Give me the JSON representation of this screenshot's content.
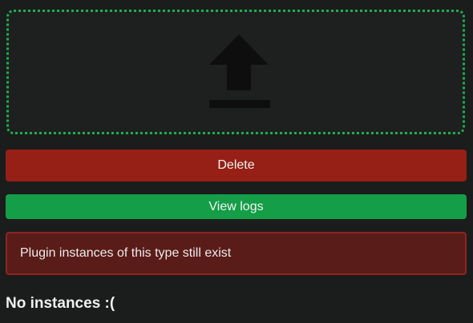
{
  "upload": {
    "icon": "upload-icon",
    "border_color": "#18b14f"
  },
  "actions": {
    "delete_label": "Delete",
    "delete_color": "#962016",
    "logs_label": "View logs",
    "logs_color": "#149e48"
  },
  "alert": {
    "message": "Plugin instances of this type still exist",
    "background": "#5a1c18"
  },
  "instances": {
    "empty_label": "No instances :("
  }
}
